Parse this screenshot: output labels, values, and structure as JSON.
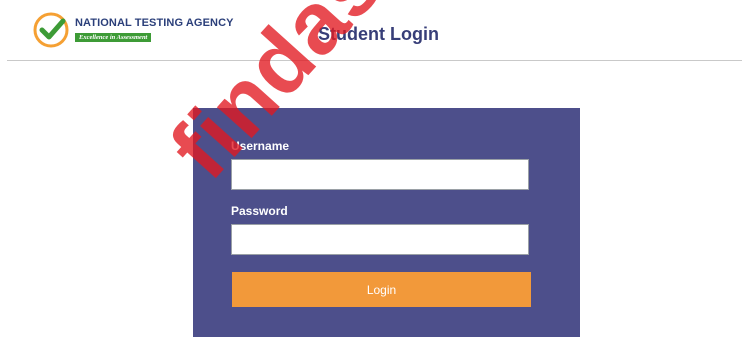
{
  "header": {
    "brand_name": "NATIONAL TESTING AGENCY",
    "brand_tagline": "Excellence in Assessment",
    "page_title": "Student Login"
  },
  "login_form": {
    "username_label": "Username",
    "username_value": "",
    "password_label": "Password",
    "password_value": "",
    "login_button_label": "Login"
  },
  "watermark": {
    "text": "findassam"
  },
  "colors": {
    "panel_background": "#4d4f8b",
    "login_button": "#f2993a",
    "title_text": "#373e78",
    "brand_text": "#2b3f7a",
    "tagline_background": "#3d9b36",
    "logo_ring": "#f5a033",
    "logo_check": "#3d9b36",
    "watermark": "#e21820"
  },
  "icons": {
    "logo": "nta-checkmark-logo"
  }
}
